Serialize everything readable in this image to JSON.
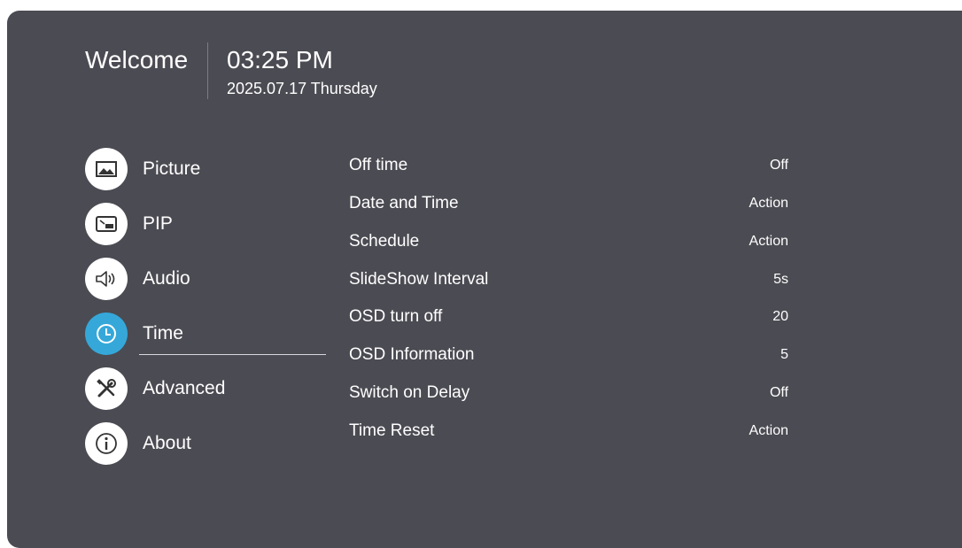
{
  "header": {
    "welcome": "Welcome",
    "time": "03:25 PM",
    "date": "2025.07.17 Thursday"
  },
  "sidebar": {
    "items": [
      {
        "label": "Picture",
        "icon": "picture-icon"
      },
      {
        "label": "PIP",
        "icon": "pip-icon"
      },
      {
        "label": "Audio",
        "icon": "speaker-icon"
      },
      {
        "label": "Time",
        "icon": "clock-icon",
        "active": true
      },
      {
        "label": "Advanced",
        "icon": "tools-icon"
      },
      {
        "label": "About",
        "icon": "info-icon"
      }
    ]
  },
  "settings": [
    {
      "label": "Off time",
      "value": "Off"
    },
    {
      "label": "Date and Time",
      "value": "Action"
    },
    {
      "label": "Schedule",
      "value": "Action"
    },
    {
      "label": "SlideShow Interval",
      "value": "5s"
    },
    {
      "label": "OSD turn off",
      "value": "20"
    },
    {
      "label": "OSD Information",
      "value": "5"
    },
    {
      "label": "Switch on Delay",
      "value": "Off"
    },
    {
      "label": "Time Reset",
      "value": "Action"
    }
  ],
  "colors": {
    "panel_bg": "#4b4b53",
    "accent": "#35a8d9",
    "text": "#ffffff"
  }
}
